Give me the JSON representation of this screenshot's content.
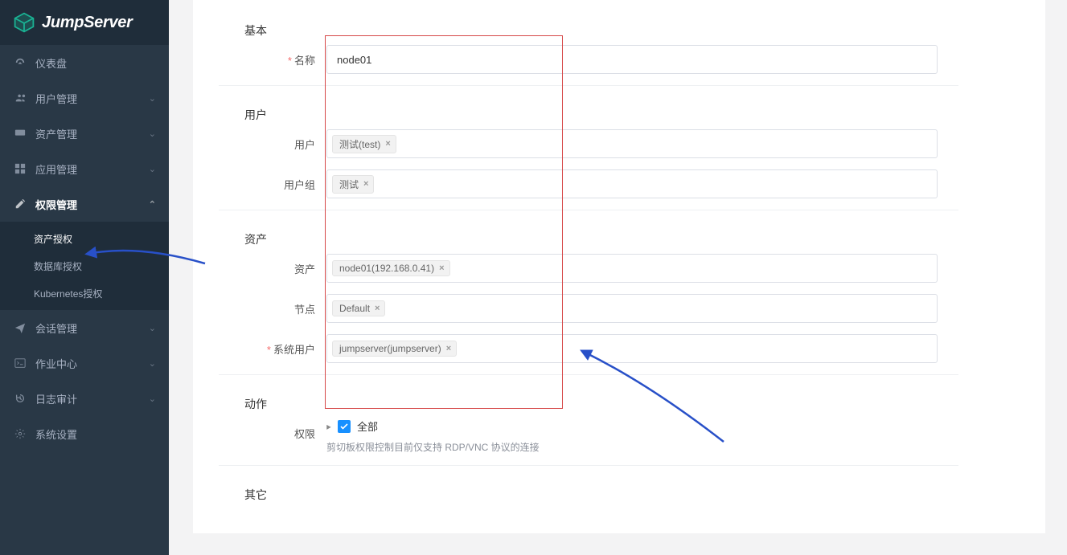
{
  "app": {
    "brand": "JumpServer"
  },
  "sidebar": {
    "items": [
      {
        "label": "仪表盘"
      },
      {
        "label": "用户管理"
      },
      {
        "label": "资产管理"
      },
      {
        "label": "应用管理"
      },
      {
        "label": "权限管理",
        "children": [
          {
            "label": "资产授权"
          },
          {
            "label": "数据库授权"
          },
          {
            "label": "Kubernetes授权"
          }
        ]
      },
      {
        "label": "会话管理"
      },
      {
        "label": "作业中心"
      },
      {
        "label": "日志审计"
      },
      {
        "label": "系统设置"
      }
    ]
  },
  "sections": {
    "basic": "基本",
    "user": "用户",
    "asset": "资产",
    "action": "动作",
    "other": "其它"
  },
  "labels": {
    "name": "名称",
    "user": "用户",
    "user_group": "用户组",
    "asset": "资产",
    "node": "节点",
    "system_user": "系统用户",
    "perm": "权限"
  },
  "form": {
    "name": "node01",
    "user_tags": [
      "测试(test)"
    ],
    "user_group_tags": [
      "测试"
    ],
    "asset_tags": [
      "node01(192.168.0.41)"
    ],
    "node_tags": [
      "Default"
    ],
    "system_user_tags": [
      "jumpserver(jumpserver)"
    ]
  },
  "perm": {
    "all_label": "全部",
    "note": "剪切板权限控制目前仅支持 RDP/VNC 协议的连接"
  }
}
